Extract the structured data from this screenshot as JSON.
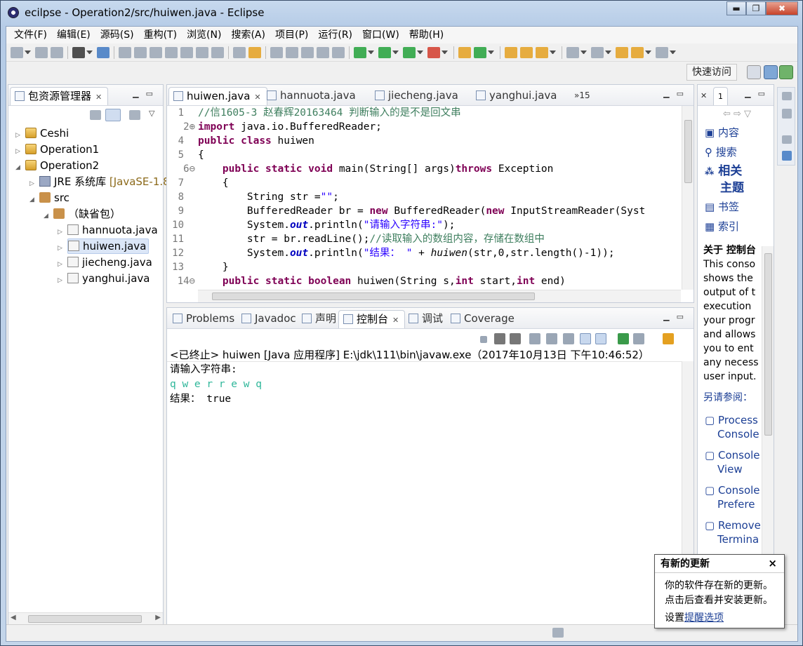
{
  "window": {
    "title": "ecilpse - Operation2/src/huiwen.java - Eclipse",
    "min": "▬",
    "max": "❐",
    "close": "✖"
  },
  "menu": [
    "文件(F)",
    "编辑(E)",
    "源码(S)",
    "重构(T)",
    "浏览(N)",
    "搜索(A)",
    "项目(P)",
    "运行(R)",
    "窗口(W)",
    "帮助(H)"
  ],
  "toolbar": {
    "quick_access": "快速访问"
  },
  "explorer": {
    "title": "包资源管理器",
    "items": [
      {
        "label": "Ceshi",
        "twisty": "▷",
        "icon": "project-icon"
      },
      {
        "label": "Operation1",
        "twisty": "▷",
        "icon": "project-icon"
      },
      {
        "label": "Operation2",
        "twisty": "◢",
        "icon": "project-icon"
      },
      {
        "label": "JRE 系统库",
        "suffix": "[JavaSE-1.8]",
        "twisty": "▷",
        "icon": "jre-library-icon"
      },
      {
        "label": "src",
        "twisty": "◢",
        "icon": "source-folder-icon"
      },
      {
        "label": "（缺省包）",
        "twisty": "◢",
        "icon": "package-icon"
      },
      {
        "label": "hannuota.java",
        "twisty": "▷",
        "icon": "java-file-icon"
      },
      {
        "label": "huiwen.java",
        "twisty": "▷",
        "icon": "java-file-icon"
      },
      {
        "label": "jiecheng.java",
        "twisty": "▷",
        "icon": "java-file-icon"
      },
      {
        "label": "yanghui.java",
        "twisty": "▷",
        "icon": "java-file-icon"
      }
    ]
  },
  "editor": {
    "tabs": [
      "huiwen.java",
      "hannuota.java",
      "jiecheng.java",
      "yanghui.java"
    ],
    "overflow": "»15",
    "lines": [
      {
        "n": "1",
        "t": "//信1605-3 赵春辉20163464 判断输入的是不是回文串"
      },
      {
        "n": "2⊕",
        "t": "import java.io.BufferedReader;"
      },
      {
        "n": "4",
        "t": "public class huiwen"
      },
      {
        "n": "5",
        "t": "{"
      },
      {
        "n": "6⊖",
        "t": "    public static void main(String[] args)throws Exception"
      },
      {
        "n": "7",
        "t": "    {"
      },
      {
        "n": "8",
        "t": "        String str =\"\";"
      },
      {
        "n": "9",
        "t": "        BufferedReader br = new BufferedReader(new InputStreamReader(Syst"
      },
      {
        "n": "10",
        "t": "        System.out.println(\"请输入字符串:\");"
      },
      {
        "n": "11",
        "t": "        str = br.readLine();//读取输入的数组内容，存储在数组中"
      },
      {
        "n": "12",
        "t": "        System.out.println(\"结果： \" + huiwen(str,0,str.length()-1));"
      },
      {
        "n": "13",
        "t": "    }"
      },
      {
        "n": "14⊖",
        "t": "    public static boolean huiwen(String s,int start,int end)"
      }
    ]
  },
  "bottom": {
    "tabs": [
      "Problems",
      "Javadoc",
      "声明",
      "控制台",
      "调试",
      "Coverage"
    ],
    "console_header": "<已终止> huiwen [Java 应用程序] E:\\jdk\\111\\bin\\javaw.exe（2017年10月13日 下午10:46:52）",
    "output": [
      "请输入字符串:",
      "q w e r r e w q",
      "结果： true"
    ]
  },
  "help": {
    "tab_num": "1",
    "links": [
      "内容",
      "搜索"
    ],
    "related": [
      "相关",
      "主题"
    ],
    "links2": [
      "书签",
      "索引"
    ],
    "about_title": "关于 控制台",
    "about_text": [
      "This conso",
      "shows the",
      "output of t",
      "execution",
      "your progr",
      "and allows",
      "you to ent",
      "any necess",
      "user input."
    ],
    "see_also": "另请参阅：",
    "refs": [
      [
        "Process",
        "Console"
      ],
      [
        "Console",
        "View"
      ],
      [
        "Console",
        "Prefere"
      ],
      [
        "Remove",
        "Termina"
      ]
    ]
  },
  "popup": {
    "title": "有新的更新",
    "close": "×",
    "line1": "你的软件存在新的更新。",
    "line2": "点击后查看并安装更新。",
    "settings": "设置",
    "link": "提醒选项"
  },
  "colors": {
    "keyword": "#7f0055",
    "comment": "#3f7f5f",
    "string": "#2a00ff",
    "stdin": "#2fb79a",
    "link": "#1c3f95"
  }
}
